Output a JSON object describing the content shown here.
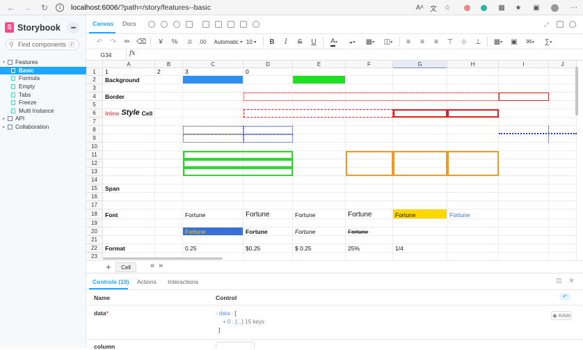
{
  "browser": {
    "url_host": "localhost:6006",
    "url_path": "/?path=/story/features--basic"
  },
  "sidebar": {
    "brand": "Storybook",
    "search_placeholder": "Find components",
    "search_shortcut": "/",
    "tree": [
      {
        "label": "Features",
        "type": "group",
        "expanded": true
      },
      {
        "label": "Basic",
        "type": "story",
        "active": true
      },
      {
        "label": "Formula",
        "type": "story"
      },
      {
        "label": "Empty",
        "type": "story"
      },
      {
        "label": "Tabs",
        "type": "story"
      },
      {
        "label": "Freeze",
        "type": "story"
      },
      {
        "label": "Multi Instance",
        "type": "story"
      },
      {
        "label": "API",
        "type": "group",
        "expanded": false
      },
      {
        "label": "Collaboration",
        "type": "group",
        "expanded": false
      }
    ]
  },
  "tabs": {
    "canvas": "Canvas",
    "docs": "Docs"
  },
  "toolbar": {
    "number_format": "Automatic",
    "font_size": "10",
    "percent": "%",
    "dec_less": ".0",
    "dec_more": ".00"
  },
  "formula_bar": {
    "cell_ref": "G34",
    "fx": "fx"
  },
  "sheet": {
    "columns": [
      "A",
      "B",
      "C",
      "D",
      "E",
      "F",
      "G",
      "H",
      "I",
      "J"
    ],
    "selected_column": "G",
    "rows": [
      "1",
      "2",
      "3",
      "4",
      "5",
      "6",
      "7",
      "8",
      "9",
      "10",
      "11",
      "12",
      "13",
      "14",
      "15",
      "16",
      "17",
      "18",
      "19",
      "20",
      "21",
      "22",
      "23"
    ],
    "cells": {
      "a1": "1",
      "b1": "2",
      "c1": "3",
      "d1": "0",
      "a2": "Background",
      "a4": "Border",
      "a6_red": "Inline",
      "a6_style": "Style",
      "a6_cell": "Cell",
      "a15": "Span",
      "a18": "Font",
      "c18": "Fortune",
      "d18": "Fortune",
      "e18": "Fortune",
      "f18": "Fortune",
      "g18": "Fortune",
      "h18": "Fortune",
      "c20": "Fortune",
      "d20": "Fortune",
      "e20": "Fortune",
      "f20": "Fortune",
      "a22": "Format",
      "c22": "0.25",
      "d22": "$0.25",
      "e22": "$ 0.25",
      "f22": "25%",
      "g22": "1/4"
    },
    "colors": {
      "blue_fill": "#2f8ff0",
      "green_fill": "#1ee01e",
      "yellow_fill": "#ffd700",
      "dark_blue_fill": "#3b6fd8",
      "red": "#e02020",
      "green_border": "#22dd22",
      "orange_border": "#f39a1e",
      "blue_dotted": "#2233cc"
    },
    "sheet_tab": "Cell"
  },
  "addons": {
    "tabs": [
      "Controls (19)",
      "Actions",
      "Interactions"
    ],
    "col_name": "Name",
    "col_control": "Control",
    "prop_name": "data",
    "prop_required": "*",
    "json_key": "data",
    "json_open": "[",
    "json_index": "0",
    "json_summary": "{...} 15 keys",
    "json_close": "]",
    "raw_label": "RAW",
    "next_prop": "column"
  }
}
